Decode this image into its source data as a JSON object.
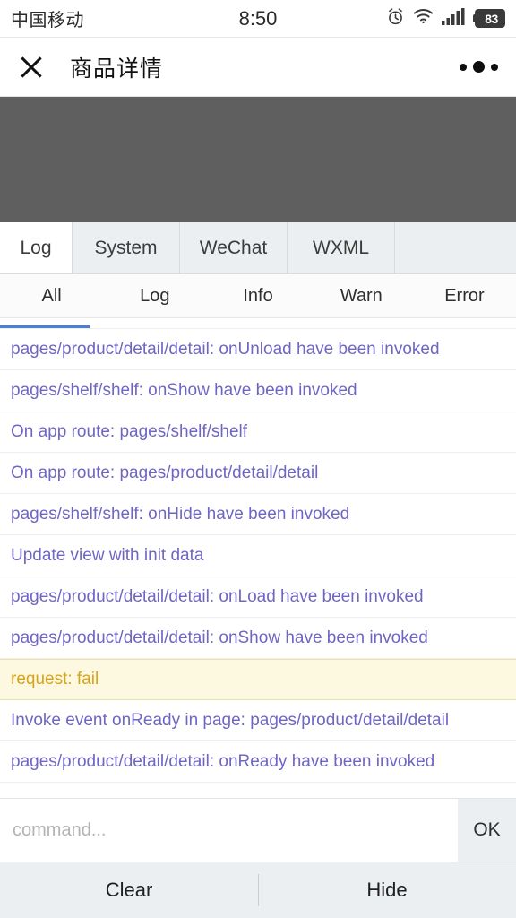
{
  "statusbar": {
    "carrier": "中国移动",
    "time": "8:50",
    "alarm_icon": "alarm-clock-icon",
    "wifi_icon": "wifi-icon",
    "signal_icon": "signal-bars-icon",
    "battery_level": "83"
  },
  "navbar": {
    "close_icon": "close-icon",
    "title": "商品详情",
    "more_icon": "more-dots-icon"
  },
  "console": {
    "tabs": [
      {
        "label": "Log",
        "active": true
      },
      {
        "label": "System",
        "active": false
      },
      {
        "label": "WeChat",
        "active": false
      },
      {
        "label": "WXML",
        "active": false
      }
    ],
    "filters": [
      {
        "label": "All",
        "active": true
      },
      {
        "label": "Log",
        "active": false
      },
      {
        "label": "Info",
        "active": false
      },
      {
        "label": "Warn",
        "active": false
      },
      {
        "label": "Error",
        "active": false
      }
    ],
    "logs": [
      {
        "text": "pages/product/detail/detail: onUnload have been invoked",
        "level": "log"
      },
      {
        "text": "pages/shelf/shelf: onShow have been invoked",
        "level": "log"
      },
      {
        "text": "On app route: pages/shelf/shelf",
        "level": "log"
      },
      {
        "text": "On app route: pages/product/detail/detail",
        "level": "log"
      },
      {
        "text": "pages/shelf/shelf: onHide have been invoked",
        "level": "log"
      },
      {
        "text": "Update view with init data",
        "level": "log"
      },
      {
        "text": "pages/product/detail/detail: onLoad have been invoked",
        "level": "log"
      },
      {
        "text": "pages/product/detail/detail: onShow have been invoked",
        "level": "log"
      },
      {
        "text": "request: fail",
        "level": "warn"
      },
      {
        "text": "Invoke event onReady in page: pages/product/detail/detail",
        "level": "log"
      },
      {
        "text": "pages/product/detail/detail: onReady have been invoked",
        "level": "log"
      }
    ],
    "command": {
      "value": "",
      "placeholder": "command...",
      "ok_label": "OK"
    },
    "actions": [
      {
        "label": "Clear"
      },
      {
        "label": "Hide"
      }
    ]
  },
  "colors": {
    "log_text": "#6f66c4",
    "warn_text": "#d9a21b",
    "warn_bg": "#fdf9e0",
    "tab_bg": "#eceff1",
    "webview_bg": "#5f5f5f",
    "filter_active_indicator": "#4a80d4"
  }
}
